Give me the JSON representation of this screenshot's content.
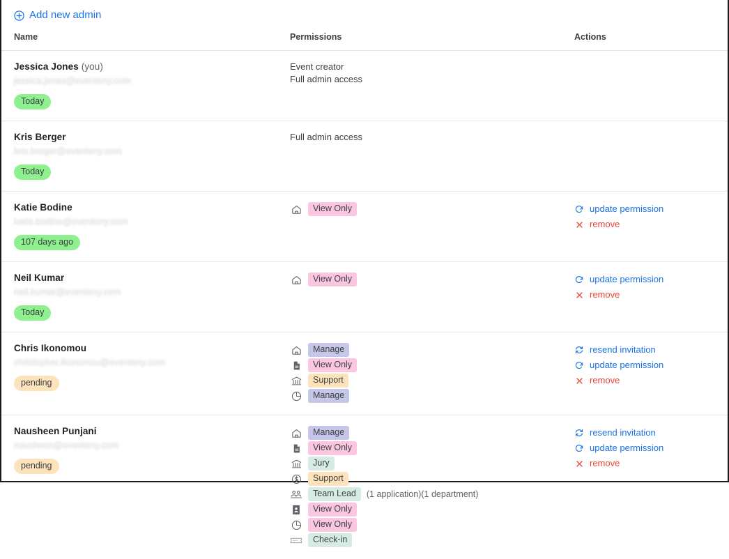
{
  "toolbar": {
    "add_admin_label": "Add new admin",
    "add_admin_icon": "plus-circle-icon",
    "accent_color": "#1a73e8"
  },
  "table": {
    "columns": {
      "name": "Name",
      "permissions": "Permissions",
      "actions": "Actions"
    },
    "rows": [
      {
        "name": "Jessica Jones",
        "suffix": " (you)",
        "email": "jessica.jones@eventeny.com",
        "status": "Today",
        "status_style": "today",
        "permissions_text": [
          "Event creator",
          "Full admin access"
        ],
        "permissions": [],
        "actions": []
      },
      {
        "name": "Kris Berger",
        "suffix": "",
        "email": "kris.berger@eventeny.com",
        "status": "Today",
        "status_style": "today",
        "permissions_text": [
          "Full admin access"
        ],
        "permissions": [],
        "actions": []
      },
      {
        "name": "Katie Bodine",
        "suffix": "",
        "email": "katie.bodine@eventeny.com",
        "status": "107 days ago",
        "status_style": "days",
        "permissions_text": [],
        "permissions": [
          {
            "icon": "home-icon",
            "label": "View Only",
            "style": "b-view",
            "note": ""
          }
        ],
        "actions": [
          {
            "icon": "refresh-icon",
            "label": "update permission",
            "danger": false
          },
          {
            "icon": "close-x-icon",
            "label": "remove",
            "danger": true
          }
        ]
      },
      {
        "name": "Neil Kumar",
        "suffix": "",
        "email": "neil.kumar@eventeny.com",
        "status": "Today",
        "status_style": "today",
        "permissions_text": [],
        "permissions": [
          {
            "icon": "home-icon",
            "label": "View Only",
            "style": "b-view",
            "note": ""
          }
        ],
        "actions": [
          {
            "icon": "refresh-icon",
            "label": "update permission",
            "danger": false
          },
          {
            "icon": "close-x-icon",
            "label": "remove",
            "danger": true
          }
        ]
      },
      {
        "name": "Chris Ikonomou",
        "suffix": "",
        "email": "christopher.ikonomou@eventeny.com",
        "status": "pending",
        "status_style": "pending",
        "permissions_text": [],
        "permissions": [
          {
            "icon": "home-icon",
            "label": "Manage",
            "style": "b-manage",
            "note": ""
          },
          {
            "icon": "document-icon",
            "label": "View Only",
            "style": "b-view",
            "note": ""
          },
          {
            "icon": "bank-icon",
            "label": "Support",
            "style": "b-support",
            "note": ""
          },
          {
            "icon": "pie-chart-icon",
            "label": "Manage",
            "style": "b-manage",
            "note": ""
          }
        ],
        "actions": [
          {
            "icon": "sync-icon",
            "label": "resend invitation",
            "danger": false
          },
          {
            "icon": "refresh-icon",
            "label": "update permission",
            "danger": false
          },
          {
            "icon": "close-x-icon",
            "label": "remove",
            "danger": true
          }
        ]
      },
      {
        "name": "Nausheen Punjani",
        "suffix": "",
        "email": "nausheen@eventeny.com",
        "status": "pending",
        "status_style": "pending",
        "permissions_text": [],
        "permissions": [
          {
            "icon": "home-icon",
            "label": "Manage",
            "style": "b-manage",
            "note": ""
          },
          {
            "icon": "document-icon",
            "label": "View Only",
            "style": "b-view",
            "note": ""
          },
          {
            "icon": "bank-icon",
            "label": "Jury",
            "style": "b-jury",
            "note": ""
          },
          {
            "icon": "dollar-circle-icon",
            "label": "Support",
            "style": "b-support",
            "note": ""
          },
          {
            "icon": "people-icon",
            "label": "Team Lead",
            "style": "b-teamlead",
            "note": "(1 application)(1 department)"
          },
          {
            "icon": "contact-card-icon",
            "label": "View Only",
            "style": "b-view",
            "note": ""
          },
          {
            "icon": "pie-chart-icon",
            "label": "View Only",
            "style": "b-view",
            "note": ""
          },
          {
            "icon": "ticket-icon",
            "label": "Check-in",
            "style": "b-checkin",
            "note": ""
          }
        ],
        "actions": [
          {
            "icon": "sync-icon",
            "label": "resend invitation",
            "danger": false
          },
          {
            "icon": "refresh-icon",
            "label": "update permission",
            "danger": false
          },
          {
            "icon": "close-x-icon",
            "label": "remove",
            "danger": true
          }
        ]
      }
    ]
  },
  "colors": {
    "link": "#1a73e8",
    "danger": "#ea4335",
    "badge_manage": "#c6c7e8",
    "badge_view_only": "#fbc6e0",
    "badge_support": "#fde3bc",
    "badge_green": "#d6ece2",
    "chip_today": "#8ef08e",
    "chip_pending": "#fde3bc"
  }
}
